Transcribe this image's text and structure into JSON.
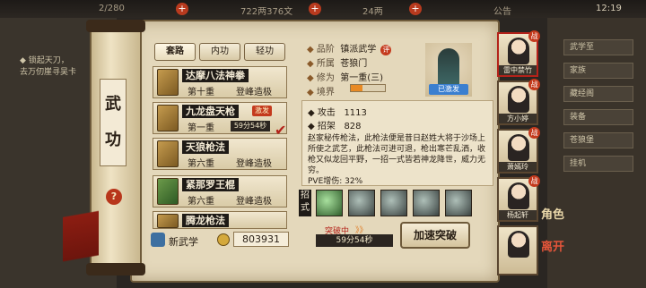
{
  "topbar": {
    "res1": "2/280",
    "res2": "722两376文",
    "res3": "24两",
    "announce": "公告",
    "time": "12:19"
  },
  "left_panel": {
    "quest": "◆ 锁起天刀，\n去万仞崖寻吴卡"
  },
  "right_buttons": [
    "武学至",
    "家族",
    "藏经阁",
    "装备",
    "苍狼堡",
    "挂机"
  ],
  "panel": {
    "title_char1": "武",
    "title_char2": "功",
    "help": "?",
    "tabs": [
      "套路",
      "内功",
      "轻功"
    ],
    "active_tab": 0
  },
  "skills": [
    {
      "name": "达摩八法神拳",
      "stage": "第十重",
      "level": "登峰造极",
      "book": "brown"
    },
    {
      "name": "九龙盘天枪",
      "stage": "第一重",
      "timer": "59分54秒",
      "badge": "激发",
      "book": "brown"
    },
    {
      "name": "天狼枪法",
      "stage": "第六重",
      "level": "登峰造极",
      "book": "brown"
    },
    {
      "name": "紧那罗王棍",
      "stage": "第六重",
      "level": "登峰造极",
      "book": "green"
    },
    {
      "name": "腾龙枪法",
      "stage": "",
      "level": "",
      "book": "brown"
    }
  ],
  "footer": {
    "new_skill": "新武学",
    "coins": "803931"
  },
  "detail": {
    "grade_label": "品阶",
    "grade_value": "镇派武学",
    "grade_badge": "评",
    "sect_label": "所属",
    "sect_value": "苍狼门",
    "cult_label": "修为",
    "cult_value": "第一重(三)",
    "realm_label": "境界",
    "realm_fill": 0.33,
    "portrait_tag": "已激发",
    "attack_label": "攻击",
    "attack_value": "1113",
    "parry_label": "招架",
    "parry_value": "828",
    "description": "赵家秘传枪法，此枪法便是昔日赵姓大将于沙场上所使之武艺，此枪法可进可退，枪出寒芒乱洒，收枪又似龙回平野，一招一式皆若神龙降世，威力无穷。",
    "pve": "PVE增伤: 32%",
    "moves_label": "招式",
    "breakthrough_label": "突破中",
    "breakthrough_arrows": "》》",
    "breakthrough_timer": "59分54秒",
    "speed_button": "加速突破"
  },
  "heroes": [
    {
      "name": "雷中禁竹",
      "badge": "战"
    },
    {
      "name": "方小婷",
      "badge": "战"
    },
    {
      "name": "萧嫣玲",
      "badge": "战"
    },
    {
      "name": "杨起轩",
      "badge": "战"
    },
    {
      "name": "",
      "badge": ""
    }
  ],
  "side": {
    "char": "角色",
    "leave": "离开"
  }
}
